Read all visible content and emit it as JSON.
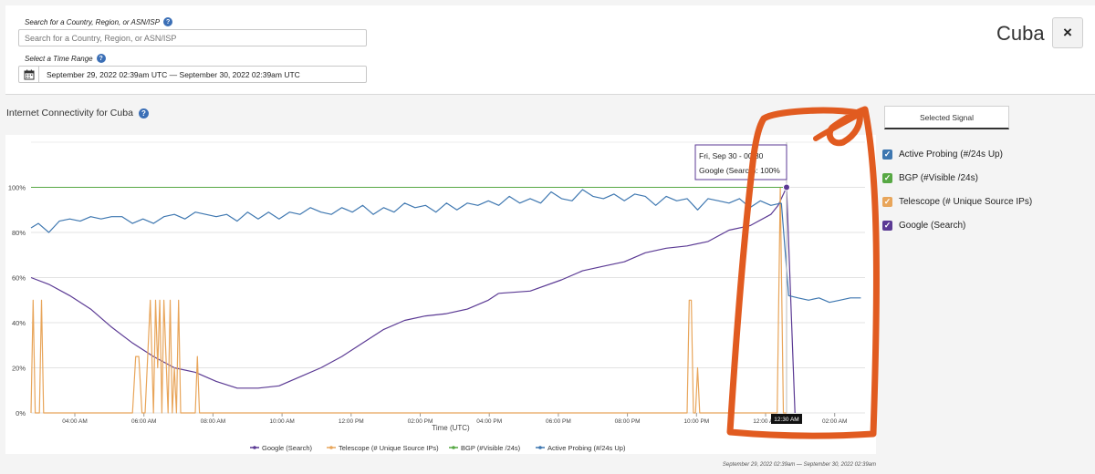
{
  "search": {
    "label": "Search for a Country, Region, or ASN/ISP",
    "placeholder": "Search for a Country, Region, or ASN/ISP"
  },
  "time_range": {
    "label": "Select a Time Range",
    "value": "September 29, 2022 02:39am UTC — September 30, 2022 02:39am UTC"
  },
  "entity_title": "Cuba",
  "close_icon": "×",
  "section_title": "Internet Connectivity for Cuba",
  "selected_signal_tab": "Selected Signal",
  "signals": [
    {
      "label": "Active Probing (#/24s Up)",
      "color": "#3e77b0",
      "checked": true
    },
    {
      "label": "BGP (#Visible /24s)",
      "color": "#57a844",
      "checked": true
    },
    {
      "label": "Telescope (# Unique Source IPs)",
      "color": "#e8a55a",
      "checked": true
    },
    {
      "label": "Google (Search)",
      "color": "#5b3a94",
      "checked": true
    }
  ],
  "tooltip": {
    "line1": "Fri, Sep 30 - 00:30",
    "line2": "Google (Search): 100%"
  },
  "hover_time_label": "12:30 AM",
  "footer_range": "September 29, 2022 02:39am — September 30, 2022 02:39am",
  "chart_data": {
    "type": "line",
    "xlabel": "Time (UTC)",
    "ylabel": "",
    "x_ticks": [
      "04:00 AM",
      "06:00 AM",
      "08:00 AM",
      "10:00 AM",
      "12:00 PM",
      "02:00 PM",
      "04:00 PM",
      "06:00 PM",
      "08:00 PM",
      "10:00 PM",
      "12:00 AM",
      "02:00 AM"
    ],
    "y_ticks": [
      "0%",
      "20%",
      "40%",
      "60%",
      "80%",
      "100%"
    ],
    "ylim": [
      0,
      120
    ],
    "grid": true,
    "legend_position": "bottom",
    "legend_order": [
      "Google (Search)",
      "Telescope (# Unique Source IPs)",
      "BGP (#Visible /24s)",
      "Active Probing (#/24s Up)"
    ],
    "series": [
      {
        "name": "Google (Search)",
        "color": "#5b3a94",
        "x": [
          2.65,
          3.5,
          4.5,
          5.5,
          6.5,
          7.5,
          8.5,
          9.5,
          10.5,
          11.5,
          12.5,
          13.5,
          14.5,
          15.5,
          16.5,
          17.5,
          18.5,
          19.5,
          20.5,
          21.5,
          22.5,
          23.5,
          24.5,
          25.0
        ],
        "y": [
          60,
          57,
          52,
          46,
          38,
          31,
          25,
          20,
          18,
          14,
          11,
          11,
          12,
          16,
          20,
          25,
          31,
          37,
          41,
          43,
          44,
          46,
          50,
          53
        ]
      },
      {
        "name": "Google (Search)",
        "color": "#5b3a94",
        "x": [
          25.0,
          26.5,
          28.0,
          29.0,
          30.0,
          31.0,
          32.0,
          33.0,
          34.0,
          35.0,
          36.0,
          37.0,
          38.0,
          38.35,
          38.75
        ],
        "y": [
          53,
          54,
          59,
          63,
          65,
          67,
          71,
          73,
          74,
          76,
          81,
          83,
          88,
          92,
          100
        ]
      },
      {
        "name": "Google (Search)",
        "color": "#5b3a94",
        "x": [
          38.75,
          39.15
        ],
        "y": [
          100,
          0
        ]
      },
      {
        "name": "Telescope (# Unique Source IPs)",
        "color": "#e8a55a",
        "x": [
          2.65,
          2.75,
          2.85,
          3.05,
          3.15,
          3.25,
          3.6,
          7.5,
          7.65,
          7.8,
          7.95,
          8.1,
          8.35,
          8.5,
          8.6,
          8.7,
          8.8,
          8.9,
          9.0,
          9.1,
          9.2,
          9.3,
          9.4,
          9.5,
          9.6,
          9.7,
          9.8,
          10.5,
          10.6,
          10.7,
          10.8,
          34.0,
          34.1,
          34.2,
          34.3,
          34.4,
          34.5,
          34.6,
          34.7,
          34.8,
          37.5,
          38.3,
          38.45,
          38.6,
          38.75
        ],
        "y": [
          0,
          50,
          0,
          0,
          50,
          0,
          0,
          0,
          25,
          25,
          0,
          0,
          50,
          0,
          50,
          20,
          50,
          0,
          50,
          25,
          0,
          50,
          0,
          20,
          0,
          50,
          0,
          0,
          25,
          0,
          0,
          0,
          50,
          50,
          0,
          0,
          20,
          0,
          0,
          0,
          0,
          0,
          100,
          0,
          0
        ]
      },
      {
        "name": "BGP (#Visible /24s)",
        "color": "#57a844",
        "x": [
          2.65,
          38.9
        ],
        "y": [
          100,
          100
        ]
      },
      {
        "name": "Active Probing (#/24s Up)",
        "color": "#3e77b0",
        "x": [
          2.65,
          3.0,
          3.5,
          4.0,
          4.5,
          5.0,
          5.5,
          6.0,
          6.5,
          7.0,
          7.5,
          8.0,
          8.5,
          9.0,
          9.5,
          10.0,
          10.5,
          11.0,
          11.5,
          12.0,
          12.5,
          13.0,
          13.5,
          14.0,
          14.5,
          15.0,
          15.5,
          16.0,
          16.5,
          17.0,
          17.5,
          18.0,
          18.5,
          19.0,
          19.5,
          20.0,
          20.5,
          21.0,
          21.5,
          22.0,
          22.5,
          23.0,
          23.5,
          24.0,
          24.5,
          25.0,
          25.5,
          26.0,
          26.5,
          27.0,
          27.5,
          28.0,
          28.5,
          29.0,
          29.5,
          30.0,
          30.5,
          31.0,
          31.5,
          32.0,
          32.5,
          33.0,
          33.5,
          34.0,
          34.5,
          35.0,
          35.5,
          36.0,
          36.5,
          37.0,
          37.5,
          38.0,
          38.5
        ],
        "y": [
          82,
          84,
          80,
          85,
          86,
          85,
          87,
          86,
          87,
          87,
          84,
          86,
          84,
          87,
          88,
          86,
          89,
          88,
          87,
          88,
          85,
          89,
          86,
          89,
          86,
          89,
          88,
          91,
          89,
          88,
          91,
          89,
          92,
          88,
          91,
          89,
          93,
          91,
          92,
          89,
          93,
          90,
          93,
          92,
          94,
          92,
          96,
          93,
          95,
          93,
          98,
          95,
          94,
          99,
          96,
          95,
          97,
          94,
          97,
          96,
          92,
          96,
          94,
          95,
          90,
          95,
          94,
          93,
          95,
          91,
          94,
          92,
          93
        ]
      },
      {
        "name": "Active Probing (#/24s Up)",
        "color": "#3e77b0",
        "x": [
          38.5,
          38.85,
          39.3,
          39.8,
          40.3,
          40.8,
          41.3,
          41.8,
          42.3
        ],
        "y": [
          93,
          52,
          51,
          50,
          51,
          49,
          50,
          51,
          51
        ]
      }
    ]
  }
}
